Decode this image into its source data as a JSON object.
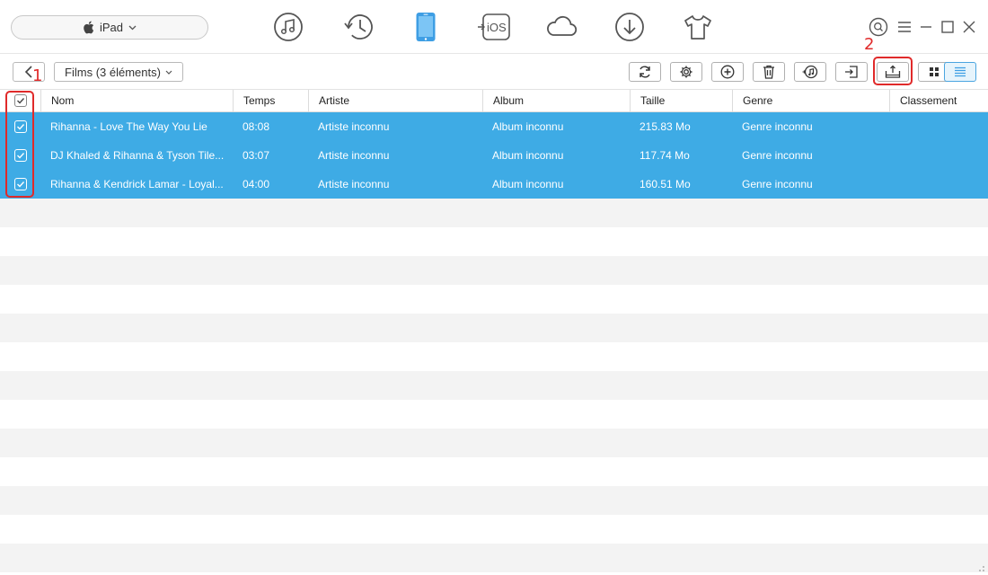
{
  "device": {
    "name": "iPad"
  },
  "nav": [
    {
      "id": "music",
      "icon": "music-icon"
    },
    {
      "id": "history",
      "icon": "history-icon"
    },
    {
      "id": "device",
      "icon": "ipad-icon"
    },
    {
      "id": "ios",
      "icon": "ios-transfer-icon",
      "label": "iOS"
    },
    {
      "id": "cloud",
      "icon": "cloud-icon"
    },
    {
      "id": "download",
      "icon": "download-icon"
    },
    {
      "id": "shop",
      "icon": "tshirt-icon"
    }
  ],
  "window": {
    "controls": [
      "search-icon",
      "menu-icon",
      "minimize-icon",
      "maximize-icon",
      "close-icon"
    ]
  },
  "toolbar": {
    "view_label": "Films (3 éléments)",
    "buttons": [
      "refresh-icon",
      "settings-icon",
      "add-icon",
      "delete-icon",
      "itunes-icon",
      "import-icon",
      "export-to-pc-icon",
      "grid-view-icon",
      "list-view-icon"
    ],
    "active_view": "list"
  },
  "annotations": {
    "step1": "1",
    "step2": "2",
    "highlight_color": "#e02a2a"
  },
  "table": {
    "columns": [
      "Nom",
      "Temps",
      "Artiste",
      "Album",
      "Taille",
      "Genre",
      "Classement"
    ],
    "rows": [
      {
        "name": "Rihanna - Love The Way You Lie",
        "time": "08:08",
        "artist": "Artiste inconnu",
        "album": "Album inconnu",
        "size": "215.83 Mo",
        "genre": "Genre inconnu",
        "rating": "",
        "checked": true
      },
      {
        "name": "DJ Khaled & Rihanna & Tyson Tile...",
        "time": "03:07",
        "artist": "Artiste inconnu",
        "album": "Album inconnu",
        "size": "117.74 Mo",
        "genre": "Genre inconnu",
        "rating": "",
        "checked": true
      },
      {
        "name": "Rihanna & Kendrick Lamar - Loyal...",
        "time": "04:00",
        "artist": "Artiste inconnu",
        "album": "Album inconnu",
        "size": "160.51 Mo",
        "genre": "Genre inconnu",
        "rating": "",
        "checked": true
      }
    ]
  },
  "colors": {
    "selection": "#3eabe5",
    "accent": "#4aa5e0",
    "stripe": "#f3f3f3"
  }
}
